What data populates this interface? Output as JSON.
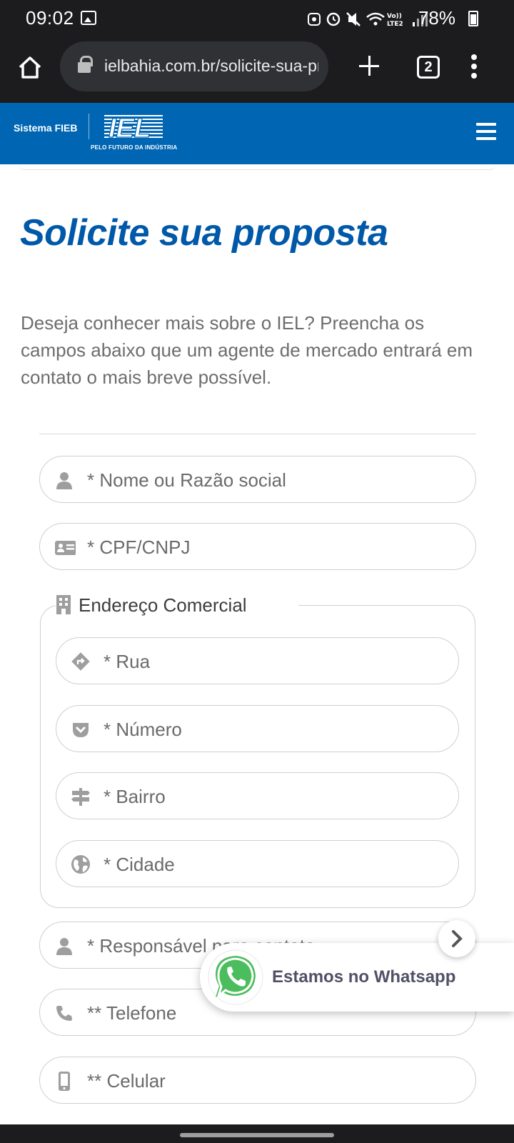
{
  "status_bar": {
    "time": "09:02",
    "battery": "78%",
    "network": "Vo) LTE2"
  },
  "browser": {
    "url": "ielbahia.com.br/solicite-sua-pro",
    "tab_count": "2"
  },
  "header": {
    "system": "Sistema FIEB",
    "logo_text": "IEL",
    "tagline": "PELO FUTURO DA INDÚSTRIA"
  },
  "page": {
    "title": "Solicite sua proposta",
    "intro": "Deseja conhecer mais sobre o IEL? Preencha os campos abaixo que um agente de mercado entrará em contato o mais breve possível."
  },
  "form": {
    "name_placeholder": "* Nome ou Razão social",
    "doc_placeholder": "* CPF/CNPJ",
    "address_legend": "Endereço Comercial",
    "street_placeholder": "* Rua",
    "number_placeholder": "* Número",
    "district_placeholder": "* Bairro",
    "city_placeholder": "* Cidade",
    "contact_placeholder": "* Responsável para contato",
    "phone_placeholder": "** Telefone",
    "mobile_placeholder": "** Celular"
  },
  "whatsapp": {
    "label": "Estamos no Whatsapp",
    "color": "#25d366"
  },
  "colors": {
    "brand_blue": "#0066b3",
    "title_blue": "#0058a8"
  }
}
